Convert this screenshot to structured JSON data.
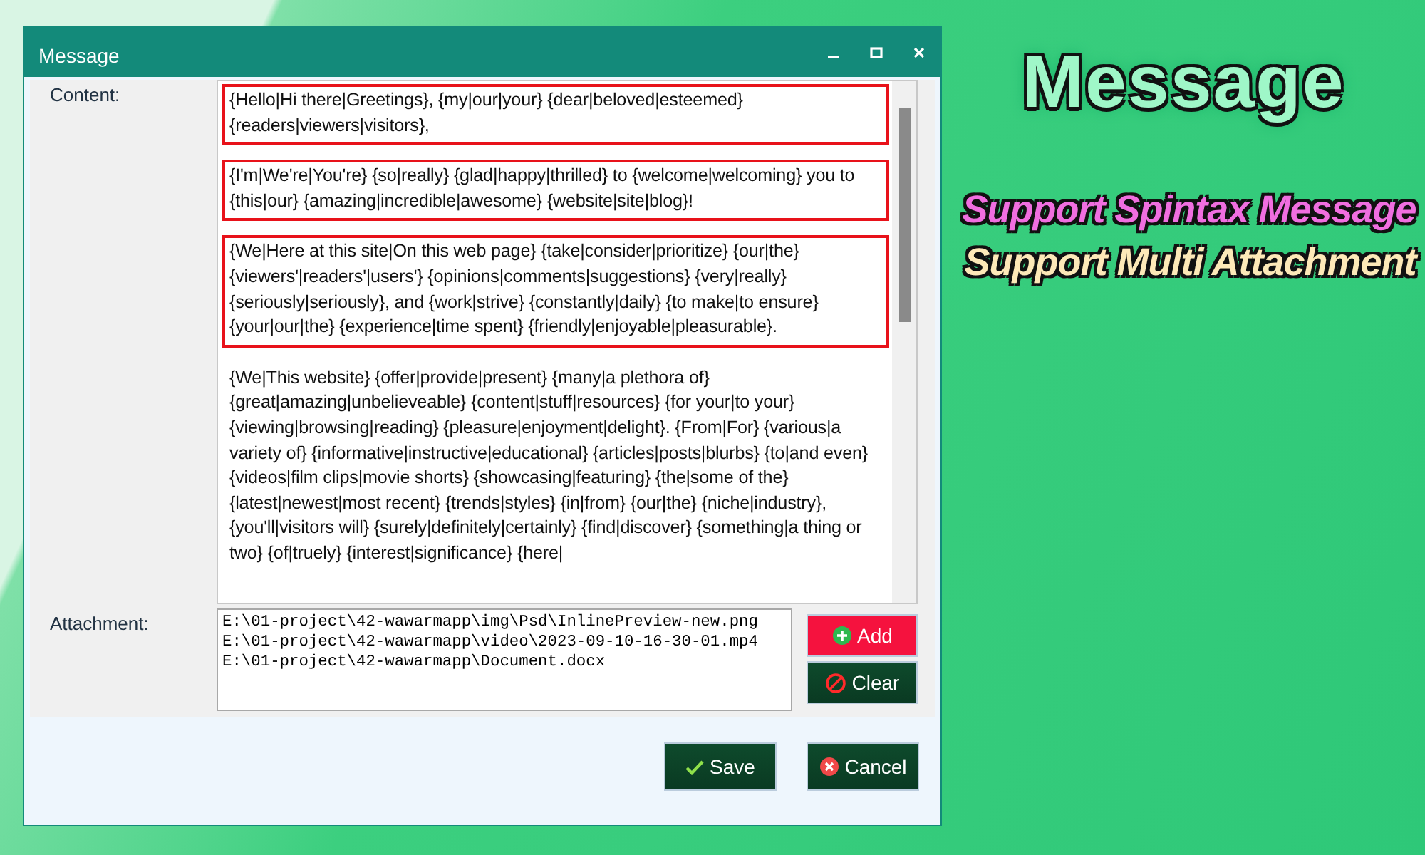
{
  "window": {
    "title": "Message",
    "controls": [
      {
        "kind": "minimize"
      },
      {
        "kind": "maximize"
      },
      {
        "kind": "close"
      }
    ]
  },
  "content": {
    "label": "Content:",
    "paragraphs": [
      {
        "text": "{Hello|Hi there|Greetings}, {my|our|your} {dear|beloved|esteemed} {readers|viewers|visitors},",
        "highlighted": true
      },
      {
        "text": "{I'm|We're|You're} {so|really} {glad|happy|thrilled} to {welcome|welcoming} you to {this|our} {amazing|incredible|awesome} {website|site|blog}!",
        "highlighted": true
      },
      {
        "text": "{We|Here at this site|On this web page} {take|consider|prioritize} {our|the} {viewers'|readers'|users'} {opinions|comments|suggestions} {very|really} {seriously|seriously}, and {work|strive} {constantly|daily} {to make|to ensure} {your|our|the} {experience|time spent} {friendly|enjoyable|pleasurable}.",
        "highlighted": true
      },
      {
        "text": "{We|This website} {offer|provide|present} {many|a plethora of} {great|amazing|unbelieveable} {content|stuff|resources} {for your|to your} {viewing|browsing|reading} {pleasure|enjoyment|delight}. {From|For} {various|a variety of} {informative|instructive|educational} {articles|posts|blurbs} {to|and even} {videos|film clips|movie shorts} {showcasing|featuring} {the|some of the} {latest|newest|most recent} {trends|styles} {in|from} {our|the} {niche|industry}, {you'll|visitors will} {surely|definitely|certainly} {find|discover} {something|a thing or two} {of|truely} {interest|significance} {here|",
        "highlighted": false
      }
    ]
  },
  "attachment": {
    "label": "Attachment:",
    "files": [
      "E:\\01-project\\42-wawarmapp\\img\\Psd\\InlinePreview-new.png",
      "E:\\01-project\\42-wawarmapp\\video\\2023-09-10-16-30-01.mp4",
      "E:\\01-project\\42-wawarmapp\\Document.docx"
    ],
    "buttons": [
      {
        "kind": "add",
        "label": "Add"
      },
      {
        "kind": "clear",
        "label": "Clear"
      }
    ]
  },
  "footer_buttons": [
    {
      "kind": "save",
      "label": "Save"
    },
    {
      "kind": "cancel",
      "label": "Cancel"
    }
  ],
  "promo": {
    "headline": "Message",
    "features": [
      {
        "text": "Support Spintax Message",
        "color": "#f06ee0"
      },
      {
        "text": "Support Multi Attachment",
        "color": "#fde9b8"
      }
    ]
  }
}
